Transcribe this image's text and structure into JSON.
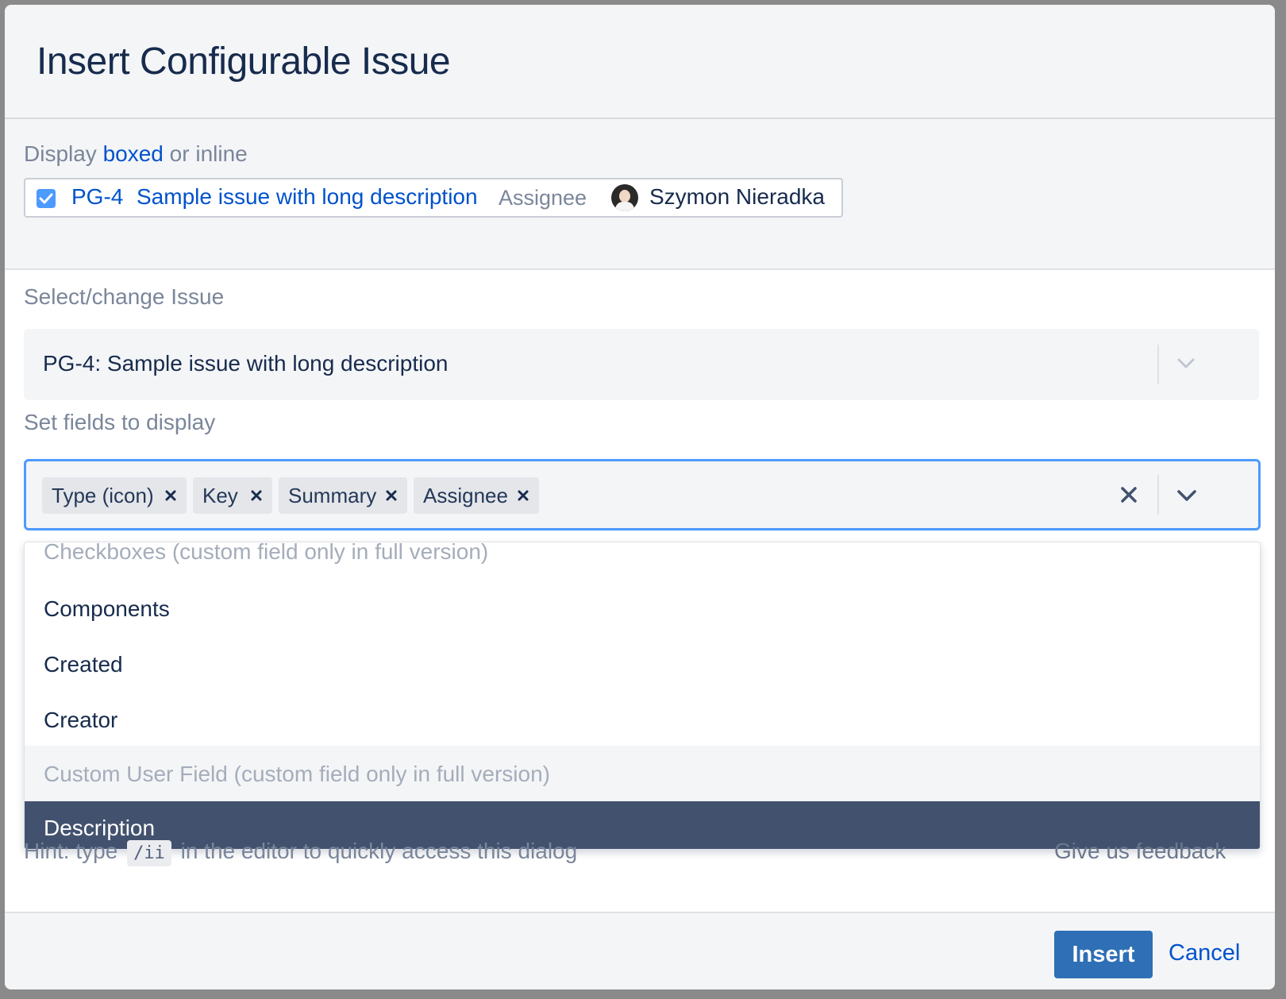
{
  "dialog": {
    "title": "Insert Configurable Issue"
  },
  "display_mode": {
    "prefix": "Display",
    "boxed": "boxed",
    "middle": "or",
    "inline": "inline"
  },
  "preview": {
    "key": "PG-4",
    "summary": "Sample issue with long description",
    "assignee_label": "Assignee",
    "assignee_name": "Szymon Nieradka",
    "checked": true
  },
  "issue_select": {
    "label": "Select/change Issue",
    "value": "PG-4: Sample issue with long description"
  },
  "fields_select": {
    "label": "Set fields to display",
    "tags": [
      "Type (icon)",
      "Key",
      "Summary",
      "Assignee"
    ]
  },
  "dropdown": {
    "options": [
      {
        "label": "Checkboxes (custom field only in full version)",
        "state": "disabled"
      },
      {
        "label": "Components",
        "state": "normal"
      },
      {
        "label": "Created",
        "state": "normal"
      },
      {
        "label": "Creator",
        "state": "normal"
      },
      {
        "label": "Custom User Field (custom field only in full version)",
        "state": "disabled-hover"
      },
      {
        "label": "Description",
        "state": "active"
      }
    ]
  },
  "hint": {
    "before": "Hint: type",
    "code": "/ii",
    "after": "in the editor to quickly access this dialog"
  },
  "feedback": "Give us feedback",
  "footer": {
    "insert": "Insert",
    "cancel": "Cancel"
  },
  "colors": {
    "accent": "#0052cc",
    "focus_border": "#4c9aff",
    "active_option": "#42526e",
    "primary_button": "#2e6fb5"
  }
}
